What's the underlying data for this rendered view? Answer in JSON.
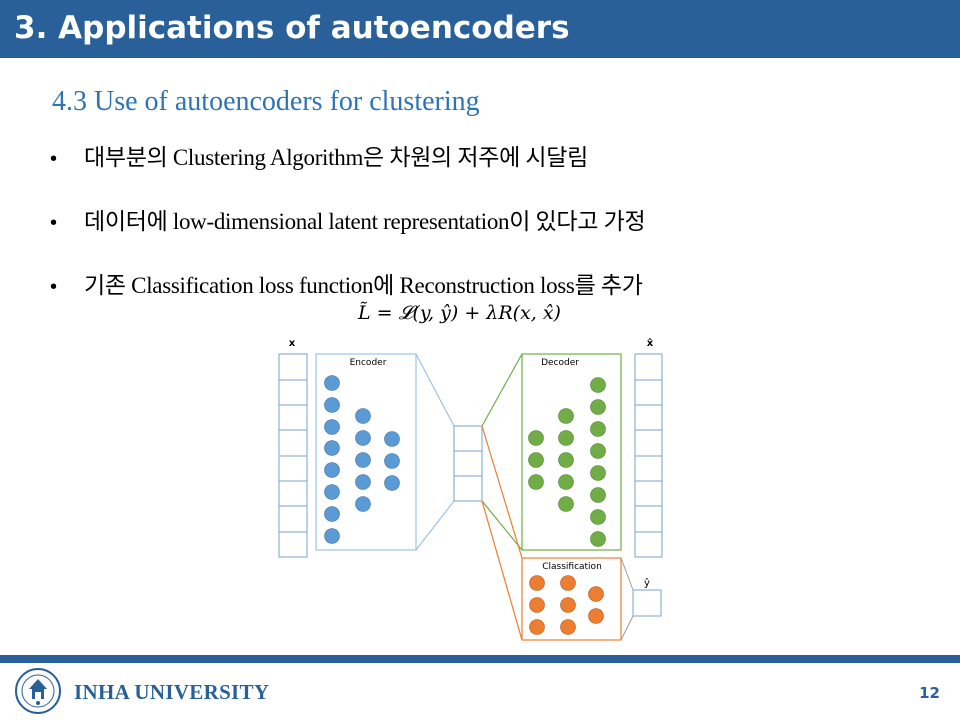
{
  "slide": {
    "title": "3. Applications of autoencoders",
    "subtitle": "4.3 Use of autoencoders for clustering",
    "bullets": [
      "대부분의 Clustering Algorithm은 차원의 저주에 시달림",
      "데이터에 low-dimensional latent representation이 있다고 가정",
      "기존 Classification loss function에 Reconstruction loss를 추가"
    ],
    "bullet_symbol": "•",
    "formula": "L̃ = 𝓛(y, ŷ) + λR(x, x̂)"
  },
  "diagram": {
    "input_label": "x",
    "output_label": "x̂",
    "encoder_label": "Encoder",
    "decoder_label": "Decoder",
    "classification_label": "Classification",
    "prediction_label": "ŷ",
    "colors": {
      "encoder_node": "#5b9bd5",
      "decoder_node": "#70ad47",
      "classification_node": "#ed7d31",
      "encoder_border": "#9dc3e6",
      "decoder_border": "#70ad47",
      "classification_border": "#ed7d31"
    }
  },
  "footer": {
    "university": "INHA UNIVERSITY",
    "page_number": "12"
  },
  "colors": {
    "title_bar": "#2a6099",
    "subtitle": "#2e74b5"
  }
}
